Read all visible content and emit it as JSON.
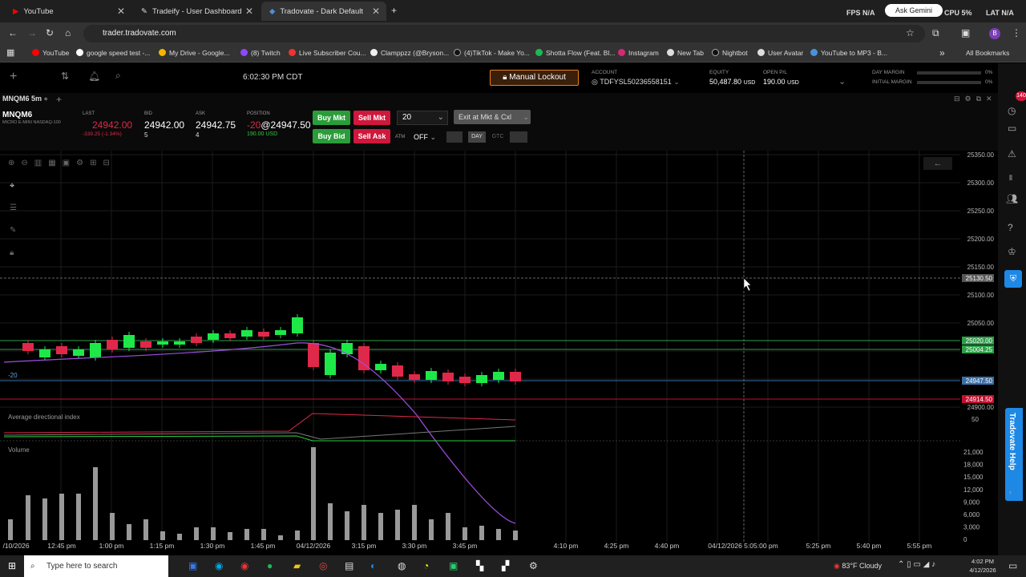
{
  "tabs": [
    {
      "label": "YouTube",
      "color": "#ff0000"
    },
    {
      "label": "Tradeify - User Dashboard",
      "color": "#ddd"
    },
    {
      "label": "Tradovate - Dark Default",
      "color": "#4a90d9"
    }
  ],
  "gemini": "Ask Gemini",
  "perf": {
    "fps": "FPS N/A",
    "cpu": "CPU 5%",
    "lat": "LAT N/A"
  },
  "url": "trader.tradovate.com",
  "bookmarks": [
    "YouTube",
    "google speed test -...",
    "My Drive - Google...",
    "(8) Twitch",
    "Live Subscriber Cou...",
    "Clamppzz (@Bryson...",
    "(4)TikTok - Make Yo...",
    "Shotta Flow (Feat. Bl...",
    "Instagram",
    "New Tab",
    "Nightbot",
    "User Avatar",
    "YouTube to MP3 - B..."
  ],
  "all_bookmarks": "All Bookmarks",
  "app": {
    "time": "6:02:30 PM CDT",
    "lockout": "Manual Lockout",
    "account_label": "ACCOUNT",
    "account": "TDFYSL50236558151",
    "equity_label": "EQUITY",
    "equity": "50,487.80",
    "usd": "USD",
    "openpl_label": "OPEN P/L",
    "openpl": "190.00",
    "day_margin": "DAY MARGIN",
    "initial_margin": "INITIAL MARGIN",
    "pct1": "0%",
    "pct2": "0%",
    "notif": "140"
  },
  "instr": {
    "tab": "MNQM6 5m",
    "symbol": "MNQM6",
    "desc": "MICRO E-MINI NASDAQ-100",
    "last_label": "LAST",
    "last": "24942.00",
    "change": "-339.25 (-1.34%)",
    "bid_label": "BID",
    "bid": "24942.00",
    "bid_size": "5",
    "ask_label": "ASK",
    "ask": "24942.75",
    "ask_size": "4",
    "pos_label": "POSITION",
    "pos_qty": "-20",
    "pos_price": "@24947.50",
    "pos_pl": "190.00 USD"
  },
  "buttons": {
    "buy_mkt": "Buy Mkt",
    "sell_mkt": "Sell Mkt",
    "qty": "20",
    "exit": "Exit at Mkt & Cxl",
    "buy_bid": "Buy Bid",
    "sell_ask": "Sell Ask",
    "atm": "ATM",
    "atm_val": "OFF",
    "day": "DAY",
    "gtc": "GTC"
  },
  "chart": {
    "y_labels": [
      "25350.00",
      "25300.00",
      "25250.00",
      "25200.00",
      "25150.00",
      "25100.00",
      "25050.00",
      "25000.00",
      "24950.00",
      "24900.00"
    ],
    "price_tags": [
      {
        "t": "25130.50",
        "c": "#555"
      },
      {
        "t": "25020.00",
        "c": "#2e9e4a"
      },
      {
        "t": "25004.25",
        "c": "#2e9e4a"
      },
      {
        "t": "24947.50",
        "c": "#3a6ea5"
      },
      {
        "t": "24914.50",
        "c": "#c01030"
      }
    ],
    "pos_label": "-20",
    "adx_label": "Average directional index",
    "adx_tick": "50",
    "vol_label": "Volume",
    "vol_ticks": [
      "21,000",
      "18,000",
      "15,000",
      "12,000",
      "9,000",
      "6,000",
      "3,000",
      "0"
    ],
    "x_labels": [
      "/10/2026",
      "12:45 pm",
      "1:00 pm",
      "1:15 pm",
      "1:30 pm",
      "1:45 pm",
      "04/12/2026",
      "3:15 pm",
      "3:30 pm",
      "3:45 pm",
      "4:10 pm",
      "4:25 pm",
      "4:40 pm",
      "04/12/2026 5:05:00 pm",
      "5:25 pm",
      "5:40 pm",
      "5:55 pm"
    ]
  },
  "help": "Tradovate Help",
  "taskbar": {
    "search": "Type here to search",
    "weather": "83°F Cloudy",
    "time": "4:02 PM",
    "date": "4/12/2026"
  }
}
